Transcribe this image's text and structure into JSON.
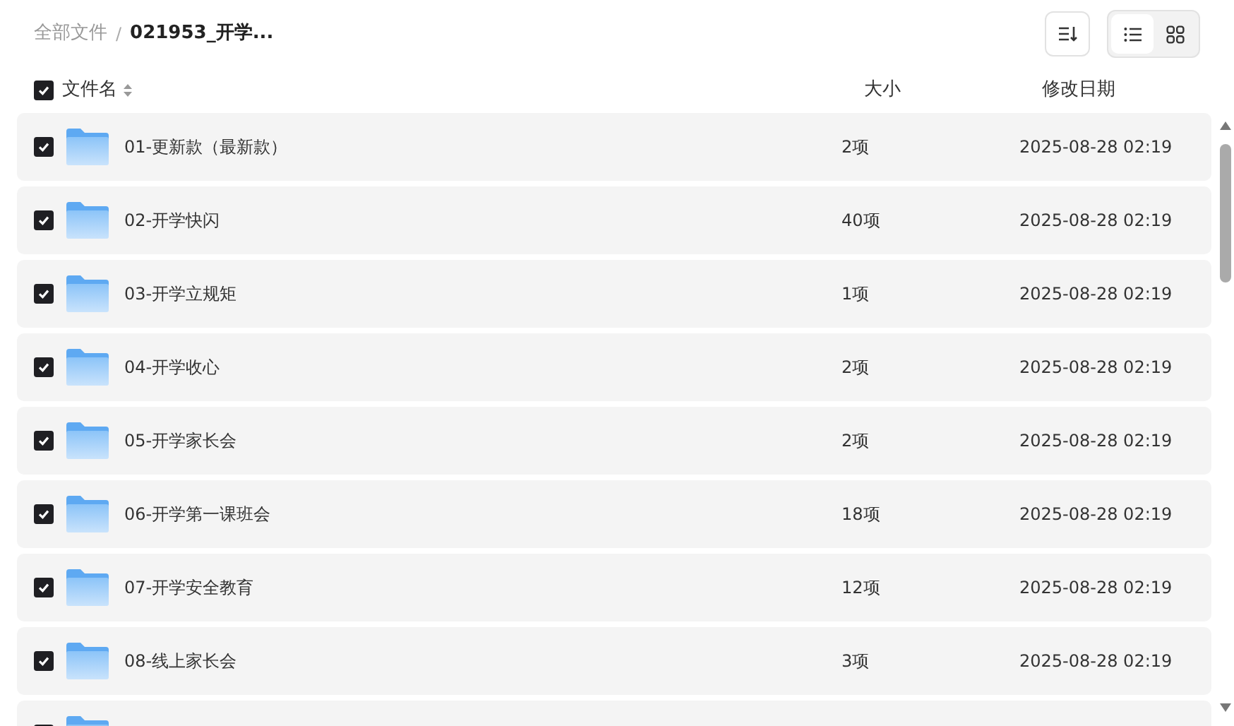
{
  "breadcrumb": [
    {
      "label": "全部文件",
      "current": false
    },
    {
      "separator": "/"
    },
    {
      "label": "021953_开学...",
      "current": true
    }
  ],
  "view_modes": [
    {
      "kind": "list",
      "selected": true
    },
    {
      "kind": "grid",
      "selected": false
    }
  ],
  "header": {
    "checked": true,
    "name": "文件名",
    "size": "大小",
    "modified": "修改日期"
  },
  "files": [
    {
      "checked": true,
      "name": "01-更新款（最新款）",
      "size": "2项",
      "modified": "2025-08-28 02:19"
    },
    {
      "checked": true,
      "name": "02-开学快闪",
      "size": "40项",
      "modified": "2025-08-28 02:19"
    },
    {
      "checked": true,
      "name": "03-开学立规矩",
      "size": "1项",
      "modified": "2025-08-28 02:19"
    },
    {
      "checked": true,
      "name": "04-开学收心",
      "size": "2项",
      "modified": "2025-08-28 02:19"
    },
    {
      "checked": true,
      "name": "05-开学家长会",
      "size": "2项",
      "modified": "2025-08-28 02:19"
    },
    {
      "checked": true,
      "name": "06-开学第一课班会",
      "size": "18项",
      "modified": "2025-08-28 02:19"
    },
    {
      "checked": true,
      "name": "07-开学安全教育",
      "size": "12项",
      "modified": "2025-08-28 02:19"
    },
    {
      "checked": true,
      "name": "08-线上家长会",
      "size": "3项",
      "modified": "2025-08-28 02:19"
    },
    {
      "checked": true
    }
  ]
}
